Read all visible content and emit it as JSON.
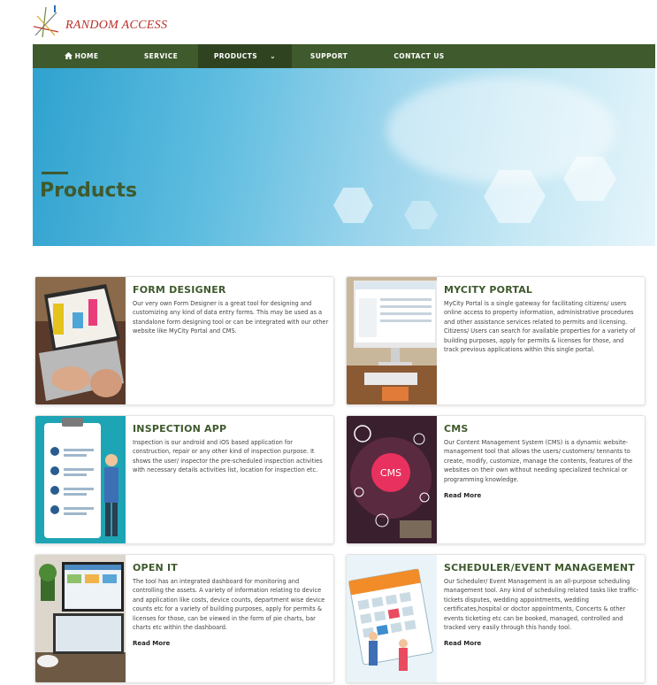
{
  "brand": {
    "name": "RANDOM ACCESS"
  },
  "nav": {
    "items": [
      {
        "label": "HOME",
        "icon": "home-icon"
      },
      {
        "label": "SERVICE"
      },
      {
        "label": "PRODUCTS",
        "icon": "chevron-down-icon",
        "active": true
      },
      {
        "label": "SUPPORT"
      },
      {
        "label": "CONTACT US"
      }
    ]
  },
  "hero": {
    "title": "Products"
  },
  "colors": {
    "brand_green": "#3f5a2d",
    "logo_red": "#b8302a",
    "hero_blue": "#5fbde0"
  },
  "products": [
    {
      "title": "FORM DESIGNER",
      "text": "Our very own Form Designer is a great tool for designing and customizing any kind of data entry forms. This may be used as a standalone form designing tool or can be integrated with our other website like MyCity Portal and CMS.",
      "read_more": ""
    },
    {
      "title": "MYCITY PORTAL",
      "text": "MyCity Portal is a single gateway for facilitating citizens/ users online access to property information, administrative procedures and other assistance services related to permits and licensing. Citizens/ Users can search for available properties for a variety of building purposes, apply for permits & licenses for those, and track previous applications within this single portal.",
      "read_more": ""
    },
    {
      "title": "INSPECTION APP",
      "text": "Inspection is our android and iOS based application for construction, repair or any other kind of inspection purpose. It shows the user/ inspector the pre-scheduled inspection activities with necessary details activities list, location for inspection etc.",
      "read_more": ""
    },
    {
      "title": "CMS",
      "text": "Our Content Management System (CMS) is a dynamic website-management tool that allows the users/ customers/ tennants to create, modify, customize, manage the contents, features of the websites on their own without needing specialized technical or programming knowledge.",
      "read_more": "Read More"
    },
    {
      "title": "OPEN IT",
      "text": "The tool has an integrated dashboard for monitoring and controlling the assets. A variety of information relating to device and application like costs, device counts, department wise device counts etc for a variety of building purposes, apply for permits & licenses for those, can be viewed in the form of pie charts, bar charts etc within the dashboard.",
      "read_more": "Read More"
    },
    {
      "title": "SCHEDULER/EVENT MANAGEMENT",
      "text": "Our Scheduler/ Event Management is an all-purpose scheduling management tool. Any kind of scheduling related tasks like traffic-tickets disputes, wedding appointments, wedding certificates,hospital or doctor appointments, Concerts & other events ticketing etc can be booked, managed, controlled and tracked very easily through this handy tool.",
      "read_more": "Read More"
    }
  ]
}
